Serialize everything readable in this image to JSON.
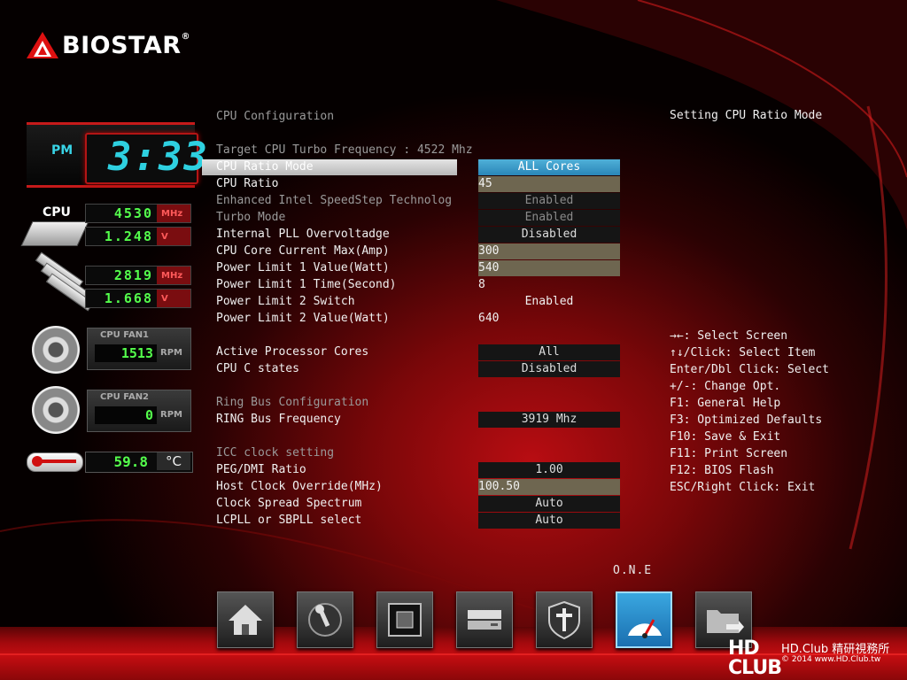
{
  "brand": {
    "name": "BIOSTAR",
    "reg": "®"
  },
  "clock": {
    "ampm": "PM",
    "time": "3:33"
  },
  "monitor": {
    "cpu_label": "CPU",
    "cpu_freq": {
      "value": "4530",
      "unit": "MHz"
    },
    "cpu_volt": {
      "value": "1.248",
      "unit": "V"
    },
    "mem_freq": {
      "value": "2819",
      "unit": "MHz"
    },
    "mem_volt": {
      "value": "1.668",
      "unit": "V"
    },
    "fan1": {
      "title": "CPU FAN1",
      "value": "1513",
      "unit": "RPM"
    },
    "fan2": {
      "title": "CPU FAN2",
      "value": "0",
      "unit": "RPM"
    },
    "temp": {
      "value": "59.8",
      "unit": "°C"
    }
  },
  "menu": {
    "section_title": "CPU Configuration",
    "target_turbo": "Target CPU Turbo Frequency : 4522 Mhz",
    "items": [
      {
        "label": "CPU Ratio Mode",
        "value": "ALL Cores"
      },
      {
        "label": "CPU Ratio",
        "value": "45"
      },
      {
        "label": "Enhanced Intel SpeedStep Technolog",
        "value": "Enabled"
      },
      {
        "label": "Turbo Mode",
        "value": "Enabled"
      },
      {
        "label": "Internal PLL Overvoltadge",
        "value": "Disabled"
      },
      {
        "label": "CPU Core Current Max(Amp)",
        "value": "300"
      },
      {
        "label": "Power Limit 1 Value(Watt)",
        "value": "540"
      },
      {
        "label": "Power Limit 1 Time(Second)",
        "value": "8"
      },
      {
        "label": "Power Limit 2 Switch",
        "value": "Enabled"
      },
      {
        "label": "Power Limit 2 Value(Watt)",
        "value": "640"
      },
      {
        "label": "Active Processor Cores",
        "value": "All"
      },
      {
        "label": "CPU C states",
        "value": "Disabled"
      },
      {
        "label": "RING Bus Frequency",
        "value": "3919 Mhz"
      },
      {
        "label": "PEG/DMI Ratio",
        "value": "1.00"
      },
      {
        "label": "Host Clock Override(MHz)",
        "value": "100.50"
      },
      {
        "label": "Clock Spread Spectrum",
        "value": "Auto"
      },
      {
        "label": "LCPLL or SBPLL select",
        "value": "Auto"
      }
    ],
    "ring_section": "Ring Bus Configuration",
    "icc_section": "ICC clock setting"
  },
  "help": {
    "title": "Setting CPU Ratio Mode",
    "keys": [
      "→←: Select Screen",
      "↑↓/Click: Select Item",
      "Enter/Dbl Click: Select",
      "+/-: Change Opt.",
      "F1: General Help",
      "F3: Optimized Defaults",
      "F10: Save & Exit",
      "F11: Print Screen",
      "F12: BIOS Flash",
      "ESC/Right Click: Exit"
    ]
  },
  "bottom": {
    "active_label": "O.N.E",
    "tiles": [
      "home-icon",
      "joystick-icon",
      "chip-icon",
      "drive-icon",
      "shield-cross-icon",
      "speedometer-icon",
      "folder-exit-icon"
    ]
  },
  "watermark": {
    "logo": "HD CLUB",
    "name": "HD.Club 精研視務所",
    "copy": "© 2014  www.HD.Club.tw"
  },
  "colors": {
    "accent": "#c40d11",
    "highlight_blue": "#3aa0d8",
    "digit_green": "#54ff4c",
    "clock_cyan": "#2ed0e0"
  }
}
